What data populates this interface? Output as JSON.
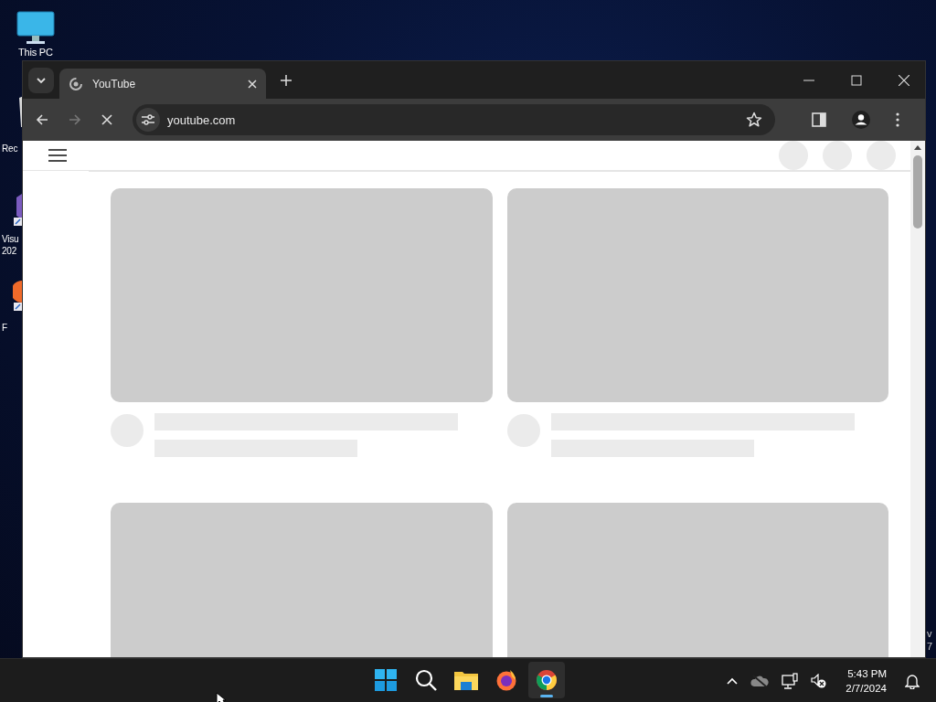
{
  "desktop": {
    "icons": [
      {
        "kind": "pc",
        "lines": [
          "This PC"
        ]
      },
      {
        "kind": "bin",
        "lines": [
          "Rec"
        ]
      },
      {
        "kind": "vs",
        "lines": [
          "Visu",
          "202"
        ]
      },
      {
        "kind": "firefox",
        "lines": [
          "F"
        ]
      }
    ],
    "edge_text": [
      "v",
      "7"
    ]
  },
  "browser": {
    "tabs": [
      {
        "title": "YouTube",
        "selected": true
      }
    ],
    "address": "youtube.com",
    "loading": true
  },
  "taskbar": {
    "apps": [
      {
        "kind": "start",
        "selected": false
      },
      {
        "kind": "search",
        "selected": false
      },
      {
        "kind": "files",
        "selected": false
      },
      {
        "kind": "firefox",
        "selected": false
      },
      {
        "kind": "chrome",
        "selected": true
      }
    ],
    "time": "5:43 PM",
    "date": "2/7/2024"
  }
}
